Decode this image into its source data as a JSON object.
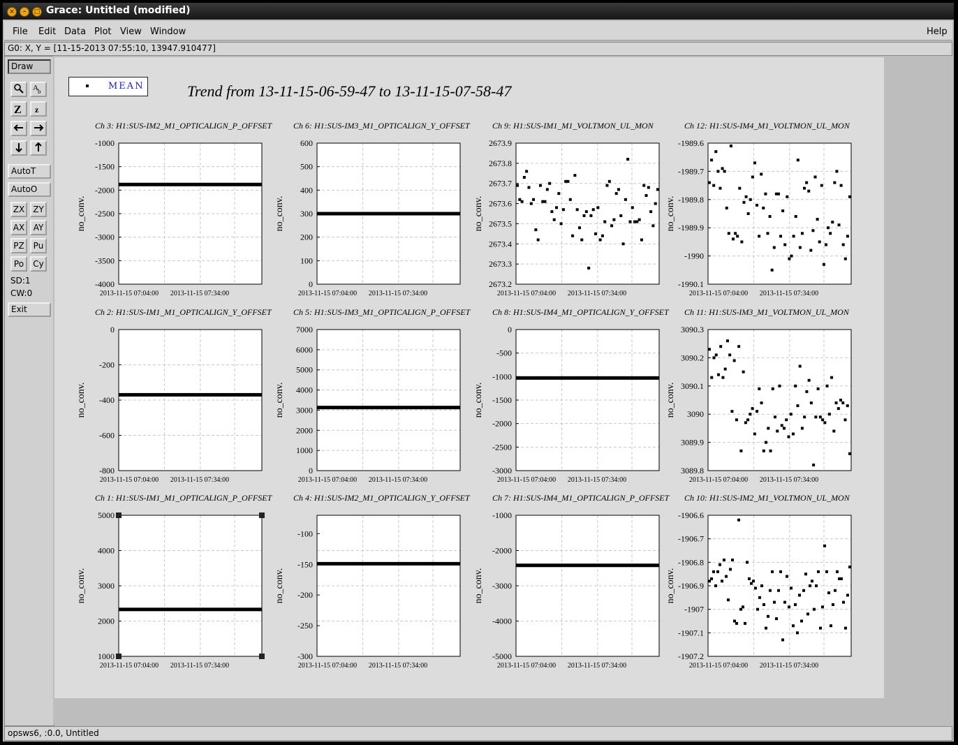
{
  "window": {
    "title": "Grace: Untitled (modified)"
  },
  "menu": {
    "file": "File",
    "edit": "Edit",
    "data": "Data",
    "plot": "Plot",
    "view": "View",
    "window": "Window",
    "help": "Help"
  },
  "locator": "G0: X, Y = [11-15-2013 07:55:10, 13947.910477]",
  "toolbar": {
    "draw": "Draw",
    "autot": "AutoT",
    "autoo": "AutoO",
    "zx": "ZX",
    "zy": "ZY",
    "ax": "AX",
    "ay": "AY",
    "pz": "PZ",
    "pu": "Pu",
    "po": "Po",
    "cy": "Cy",
    "sd": "SD:1",
    "cw": "CW:0",
    "exit": "Exit",
    "icons": [
      "zoom-icon",
      "text-icon",
      "autoscale-z-icon",
      "zoom-z-icon",
      "arrow-left-icon",
      "arrow-right-icon",
      "arrow-down-icon",
      "arrow-up-icon"
    ]
  },
  "status": "opsws6, :0.0, Untitled",
  "legend": {
    "label": "MEAN"
  },
  "plot_title": "Trend from 13-11-15-06-59-47 to 13-11-15-07-58-47",
  "chart_data": [
    {
      "type": "line",
      "title": "Ch 3: H1:SUS-IM2_M1_OPTICALIGN_P_OFFSET",
      "ylabel": "no_conv.",
      "ylim": [
        -4000,
        -1000
      ],
      "yticks": [
        "-1000",
        "-1500",
        "-2000",
        "-2500",
        "-3000",
        "-3500",
        "-4000"
      ],
      "xticks": [
        "2013-11-15 07:04:00",
        "2013-11-15 07:34:00"
      ],
      "mode": "flat",
      "value": -1880,
      "series": [
        {
          "name": "MEAN"
        }
      ]
    },
    {
      "type": "line",
      "title": "Ch 6: H1:SUS-IM3_M1_OPTICALIGN_Y_OFFSET",
      "ylabel": "no_conv.",
      "ylim": [
        0,
        600
      ],
      "yticks": [
        "600",
        "500",
        "400",
        "300",
        "200",
        "100",
        "0"
      ],
      "xticks": [
        "2013-11-15 07:04:00",
        "2013-11-15 07:34:00"
      ],
      "mode": "flat",
      "value": 300,
      "series": [
        {
          "name": "MEAN"
        }
      ]
    },
    {
      "type": "scatter",
      "title": "Ch 9: H1:SUS-IM1_M1_VOLTMON_UL_MON",
      "ylabel": "no_conv.",
      "ylim": [
        2673.2,
        2673.9
      ],
      "yticks": [
        "2673.9",
        "2673.8",
        "2673.7",
        "2673.6",
        "2673.5",
        "2673.4",
        "2673.3",
        "2673.2"
      ],
      "xticks": [
        "2013-11-15 07:04:00",
        "2013-11-15 07:34:00"
      ],
      "mode": "scatter",
      "values": [
        2673.69,
        2673.62,
        2673.61,
        2673.73,
        2673.76,
        2673.68,
        2673.6,
        2673.62,
        2673.47,
        2673.42,
        2673.69,
        2673.61,
        2673.61,
        2673.67,
        2673.7,
        2673.56,
        2673.52,
        2673.58,
        2673.65,
        2673.5,
        2673.57,
        2673.71,
        2673.71,
        2673.62,
        2673.44,
        2673.74,
        2673.57,
        2673.48,
        2673.42,
        2673.54,
        2673.56,
        2673.28,
        2673.54,
        2673.57,
        2673.45,
        2673.58,
        2673.42,
        2673.44,
        2673.51,
        2673.69,
        2673.71,
        2673.49,
        2673.52,
        2673.65,
        2673.67,
        2673.54,
        2673.4,
        2673.62,
        2673.82,
        2673.51,
        2673.58,
        2673.51,
        2673.51,
        2673.52,
        2673.42,
        2673.69,
        2673.64,
        2673.68,
        2673.56,
        2673.49,
        2673.6,
        2673.67
      ],
      "series": [
        {
          "name": "MEAN"
        }
      ]
    },
    {
      "type": "scatter",
      "title": "Ch 12: H1:SUS-IM4_M1_VOLTMON_UL_MON",
      "ylabel": "no_conv.",
      "ylim": [
        -1990.1,
        -1989.6
      ],
      "yticks": [
        "-1989.6",
        "-1989.7",
        "-1989.8",
        "-1989.9",
        "-1990",
        "-1990.1"
      ],
      "xticks": [
        "2013-11-15 07:04:00",
        "2013-11-15 07:34:00"
      ],
      "mode": "scatter",
      "values": [
        -1989.74,
        -1989.66,
        -1989.75,
        -1989.63,
        -1989.7,
        -1989.76,
        -1989.69,
        -1989.7,
        -1989.83,
        -1989.92,
        -1989.61,
        -1989.94,
        -1989.92,
        -1989.93,
        -1989.76,
        -1989.95,
        -1989.81,
        -1989.79,
        -1989.85,
        -1989.8,
        -1989.72,
        -1989.67,
        -1989.82,
        -1989.93,
        -1989.71,
        -1989.83,
        -1989.78,
        -1989.92,
        -1989.86,
        -1990.05,
        -1989.97,
        -1989.78,
        -1989.78,
        -1989.93,
        -1989.84,
        -1989.96,
        -1989.79,
        -1990.01,
        -1990,
        -1989.93,
        -1989.86,
        -1989.66,
        -1989.97,
        -1989.92,
        -1989.76,
        -1989.74,
        -1989.77,
        -1989.98,
        -1989.91,
        -1989.72,
        -1989.87,
        -1989.95,
        -1989.75,
        -1990.03,
        -1989.96,
        -1989.9,
        -1989.92,
        -1989.88,
        -1989.74,
        -1989.7,
        -1989.89,
        -1989.75,
        -1989.96,
        -1990.01,
        -1989.93,
        -1989.79
      ],
      "series": [
        {
          "name": "MEAN"
        }
      ]
    },
    {
      "type": "line",
      "title": "Ch 2: H1:SUS-IM1_M1_OPTICALIGN_Y_OFFSET",
      "ylabel": "no_conv.",
      "ylim": [
        -800,
        0
      ],
      "yticks": [
        "0",
        "-200",
        "-400",
        "-600",
        "-800"
      ],
      "xticks": [
        "2013-11-15 07:04:00",
        "2013-11-15 07:34:00"
      ],
      "mode": "flat",
      "value": -370,
      "series": [
        {
          "name": "MEAN"
        }
      ]
    },
    {
      "type": "line",
      "title": "Ch 5: H1:SUS-IM3_M1_OPTICALIGN_P_OFFSET",
      "ylabel": "no_conv.",
      "ylim": [
        0,
        7000
      ],
      "yticks": [
        "7000",
        "6000",
        "5000",
        "4000",
        "3000",
        "2000",
        "1000",
        "0"
      ],
      "xticks": [
        "2013-11-15 07:04:00",
        "2013-11-15 07:34:00"
      ],
      "mode": "flat",
      "value": 3130,
      "series": [
        {
          "name": "MEAN"
        }
      ]
    },
    {
      "type": "line",
      "title": "Ch 8: H1:SUS-IM4_M1_OPTICALIGN_Y_OFFSET",
      "ylabel": "no_conv.",
      "ylim": [
        -3000,
        0
      ],
      "yticks": [
        "0",
        "-500",
        "-1000",
        "-1500",
        "-2000",
        "-2500",
        "-3000"
      ],
      "xticks": [
        "2013-11-15 07:04:00",
        "2013-11-15 07:34:00"
      ],
      "mode": "flat",
      "value": -1030,
      "series": [
        {
          "name": "MEAN"
        }
      ]
    },
    {
      "type": "scatter",
      "title": "Ch 11: H1:SUS-IM3_M1_VOLTMON_UL_MON",
      "ylabel": "no_conv.",
      "ylim": [
        3089.8,
        3090.3
      ],
      "yticks": [
        "3090.3",
        "3090.2",
        "3090.1",
        "3090",
        "3089.9",
        "3089.8"
      ],
      "xticks": [
        "2013-11-15 07:04:00",
        "2013-11-15 07:34:00"
      ],
      "mode": "scatter",
      "values": [
        3090.23,
        3090.13,
        3090.2,
        3090.21,
        3090.14,
        3090.24,
        3090.13,
        3090.16,
        3090.26,
        3090.21,
        3090.01,
        3090.19,
        3089.98,
        3090.24,
        3089.87,
        3090.15,
        3089.97,
        3089.98,
        3090.0,
        3090.02,
        3089.93,
        3090.01,
        3090.09,
        3090.04,
        3089.87,
        3089.9,
        3089.95,
        3089.87,
        3090.09,
        3089.99,
        3089.94,
        3090.1,
        3089.96,
        3089.95,
        3089.98,
        3089.92,
        3090.0,
        3089.93,
        3090.1,
        3090.03,
        3090.17,
        3089.95,
        3089.99,
        3090.08,
        3090.12,
        3090.04,
        3089.82,
        3089.99,
        3090.09,
        3089.99,
        3089.98,
        3089.97,
        3090.1,
        3090.0,
        3090.13,
        3089.94,
        3090.04,
        3090.02,
        3090.05,
        3090.04,
        3089.98,
        3090.03,
        3089.86
      ],
      "series": [
        {
          "name": "MEAN"
        }
      ]
    },
    {
      "type": "line",
      "title": "Ch 1: H1:SUS-IM1_M1_OPTICALIGN_P_OFFSET",
      "ylabel": "no_conv.",
      "ylim": [
        1000,
        5000
      ],
      "yticks": [
        "5000",
        "4000",
        "3000",
        "2000",
        "1000"
      ],
      "xticks": [
        "2013-11-15 07:04:00",
        "2013-11-15 07:34:00"
      ],
      "mode": "flat",
      "value": 2330,
      "series": [
        {
          "name": "MEAN"
        }
      ]
    },
    {
      "type": "line",
      "title": "Ch 4: H1:SUS-IM2_M1_OPTICALIGN_Y_OFFSET",
      "ylabel": "no_conv.",
      "ylim": [
        -300,
        -70
      ],
      "yticks": [
        "-100",
        "-150",
        "-200",
        "-250",
        "-300"
      ],
      "xticks": [
        "2013-11-15 07:04:00",
        "2013-11-15 07:34:00"
      ],
      "mode": "flat",
      "value": -149,
      "series": [
        {
          "name": "MEAN"
        }
      ]
    },
    {
      "type": "line",
      "title": "Ch 7: H1:SUS-IM4_M1_OPTICALIGN_P_OFFSET",
      "ylabel": "no_conv.",
      "ylim": [
        -5000,
        -1000
      ],
      "yticks": [
        "-1000",
        "-2000",
        "-3000",
        "-4000",
        "-5000"
      ],
      "xticks": [
        "2013-11-15 07:04:00",
        "2013-11-15 07:34:00"
      ],
      "mode": "flat",
      "value": -2420,
      "series": [
        {
          "name": "MEAN"
        }
      ]
    },
    {
      "type": "scatter",
      "title": "Ch 10: H1:SUS-IM2_M1_VOLTMON_UL_MON",
      "ylabel": "no_conv.",
      "ylim": [
        -1907.2,
        -1906.6
      ],
      "yticks": [
        "-1906.6",
        "-1906.7",
        "-1906.8",
        "-1906.9",
        "-1907",
        "-1907.1",
        "-1907.2"
      ],
      "xticks": [
        "2013-11-15 07:04:00",
        "2013-11-15 07:34:00"
      ],
      "mode": "scatter",
      "values": [
        -1906.88,
        -1906.87,
        -1906.84,
        -1906.9,
        -1906.84,
        -1906.81,
        -1906.88,
        -1906.79,
        -1906.86,
        -1906.96,
        -1906.83,
        -1906.79,
        -1907.05,
        -1907.06,
        -1906.62,
        -1907.0,
        -1906.99,
        -1907.06,
        -1906.8,
        -1906.87,
        -1906.89,
        -1906.88,
        -1906.91,
        -1907.0,
        -1906.95,
        -1906.9,
        -1906.98,
        -1907.08,
        -1907.03,
        -1906.92,
        -1906.84,
        -1906.97,
        -1907.04,
        -1906.92,
        -1906.84,
        -1907.13,
        -1906.97,
        -1906.86,
        -1906.99,
        -1906.91,
        -1907.07,
        -1906.98,
        -1907.1,
        -1906.94,
        -1907.05,
        -1906.92,
        -1906.85,
        -1907.02,
        -1906.9,
        -1906.88,
        -1907.0,
        -1906.9,
        -1906.84,
        -1907.08,
        -1906.99,
        -1906.73,
        -1906.84,
        -1906.93,
        -1907.07,
        -1906.98,
        -1906.92,
        -1906.84,
        -1906.87,
        -1906.87,
        -1906.97,
        -1907.08,
        -1906.94,
        -1906.82
      ],
      "series": [
        {
          "name": "MEAN"
        }
      ]
    }
  ]
}
